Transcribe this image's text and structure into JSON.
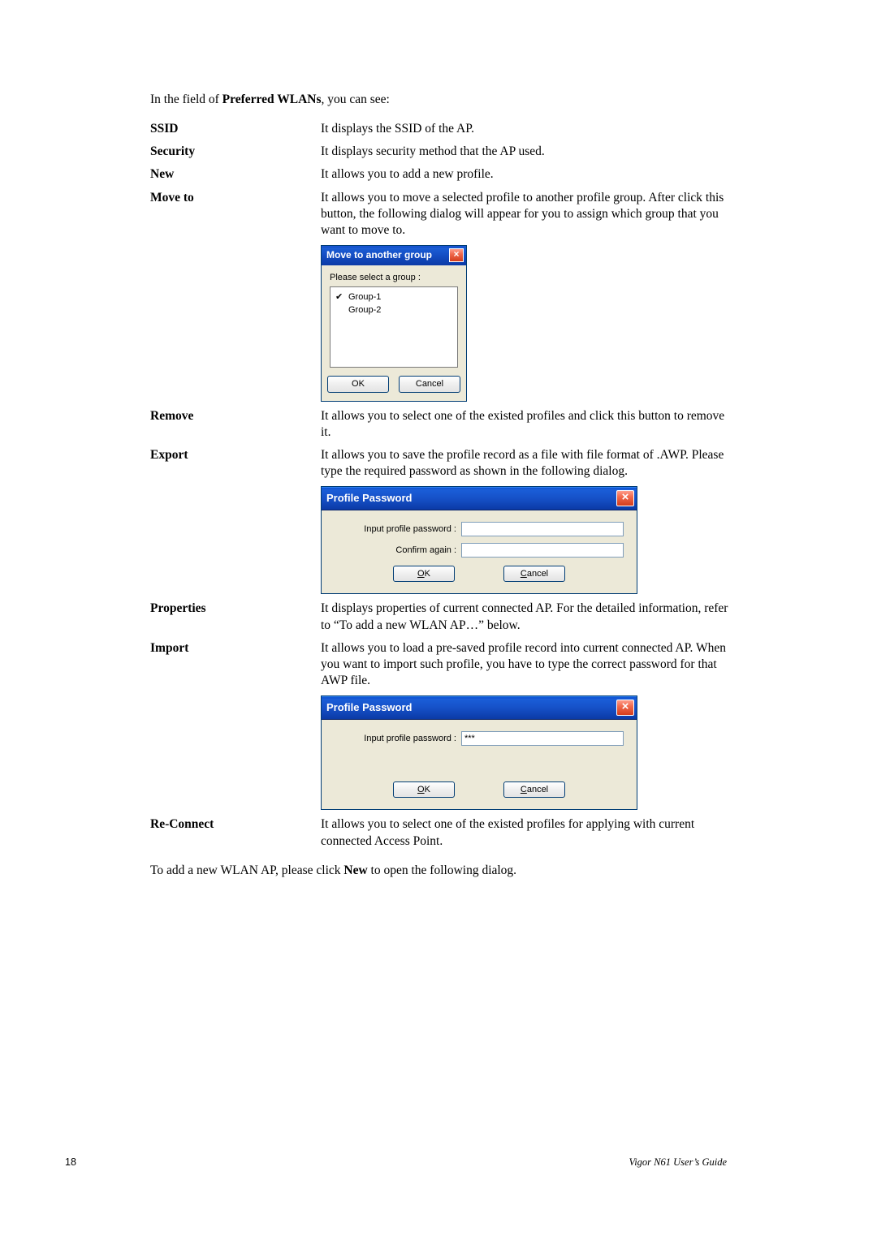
{
  "intro_pre": "In the field of ",
  "intro_bold": "Preferred WLANs",
  "intro_post": ", you can see:",
  "defs": {
    "ssid": {
      "term": "SSID",
      "desc": "It displays the SSID of the AP."
    },
    "security": {
      "term": "Security",
      "desc": "It displays security method that the AP used."
    },
    "newp": {
      "term": "New",
      "desc": "It allows you to add a new profile."
    },
    "moveto": {
      "term": "Move to",
      "desc": "It allows you to move a selected profile to another profile group. After click this button, the following dialog will appear for you to assign which group that you want to move to."
    },
    "remove": {
      "term": "Remove",
      "desc": "It allows you to select one of the existed profiles and click this button to remove it."
    },
    "export": {
      "term": "Export",
      "desc": "It allows you to save the profile record as a file with file format of .AWP. Please type the required password as shown in the following dialog."
    },
    "properties": {
      "term": "Properties",
      "desc": "It displays properties of current connected AP. For the detailed information, refer to “To add a new WLAN AP…” below."
    },
    "import": {
      "term": "Import",
      "desc": "It allows you to load a pre-saved profile record into current connected AP. When you want to import such profile, you have to type the correct password for that AWP file."
    },
    "reconnect": {
      "term": "Re-Connect",
      "desc": "It allows you to select one of the existed profiles for applying with current connected Access Point."
    }
  },
  "move_dialog": {
    "title": "Move to another group",
    "prompt": "Please select a group :",
    "groups": [
      "Group-1",
      "Group-2"
    ],
    "selected_index": 0,
    "ok": "OK",
    "cancel": "Cancel"
  },
  "profile_dialog_export": {
    "title": "Profile Password",
    "label1": "Input profile password :",
    "label2": "Confirm again :",
    "ok_letter": "O",
    "ok_rest": "K",
    "cancel_letter": "C",
    "cancel_rest": "ancel"
  },
  "profile_dialog_import": {
    "title": "Profile Password",
    "label1": "Input profile password :",
    "value1": "***",
    "ok_letter": "O",
    "ok_rest": "K",
    "cancel_letter": "C",
    "cancel_rest": "ancel"
  },
  "outro_pre": "To add a new WLAN AP, please click ",
  "outro_bold": "New",
  "outro_post": " to open the following dialog.",
  "footer": {
    "page": "18",
    "guide": "Vigor N61 User’s Guide"
  }
}
